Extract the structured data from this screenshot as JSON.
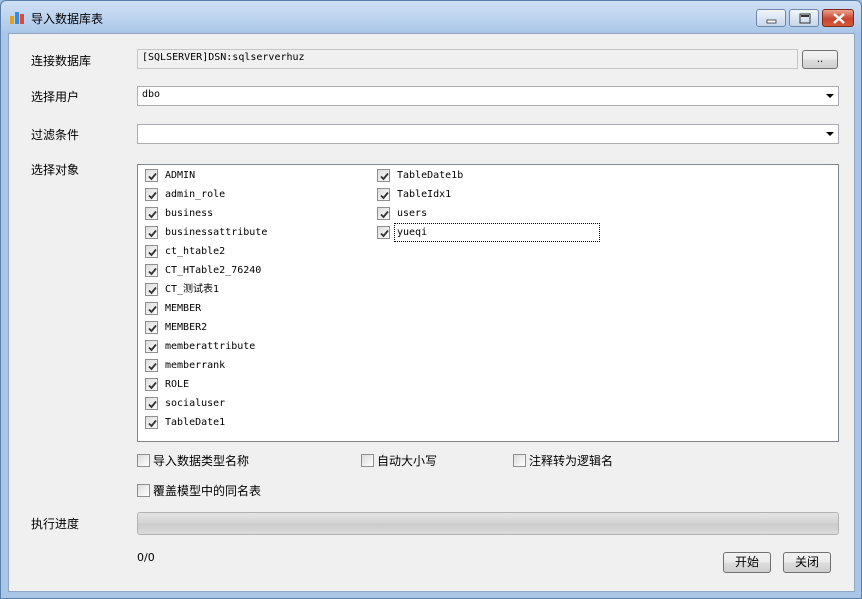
{
  "window": {
    "title": "导入数据库表"
  },
  "form": {
    "connection_label": "连接数据库",
    "connection_value": "[SQLSERVER]DSN:sqlserverhuz",
    "browse_label": "..",
    "user_label": "选择用户",
    "user_value": "dbo",
    "filter_label": "过滤条件",
    "filter_value": "",
    "objects_label": "选择对象",
    "objects": [
      {
        "name": "ADMIN",
        "checked": true
      },
      {
        "name": "admin_role",
        "checked": true
      },
      {
        "name": "business",
        "checked": true
      },
      {
        "name": "businessattribute",
        "checked": true
      },
      {
        "name": "ct_htable2",
        "checked": true
      },
      {
        "name": "CT_HTable2_76240",
        "checked": true
      },
      {
        "name": "CT_测试表1",
        "checked": true
      },
      {
        "name": "MEMBER",
        "checked": true
      },
      {
        "name": "MEMBER2",
        "checked": true
      },
      {
        "name": "memberattribute",
        "checked": true
      },
      {
        "name": "memberrank",
        "checked": true
      },
      {
        "name": "ROLE",
        "checked": true
      },
      {
        "name": "socialuser",
        "checked": true
      },
      {
        "name": "TableDate1",
        "checked": true
      },
      {
        "name": "TableDate1b",
        "checked": true
      },
      {
        "name": "TableIdx1",
        "checked": true
      },
      {
        "name": "users",
        "checked": true
      },
      {
        "name": "yueqi",
        "checked": true
      }
    ],
    "options": {
      "import_type_name": {
        "label": "导入数据类型名称",
        "checked": false
      },
      "auto_case": {
        "label": "自动大小写",
        "checked": false
      },
      "comment_to_logical": {
        "label": "注释转为逻辑名",
        "checked": false
      },
      "overwrite_same_name": {
        "label": "覆盖模型中的同名表",
        "checked": false
      }
    },
    "progress_label": "执行进度",
    "progress_fraction": 0,
    "progress_text": "0/0",
    "start_label": "开始",
    "close_label": "关闭"
  }
}
